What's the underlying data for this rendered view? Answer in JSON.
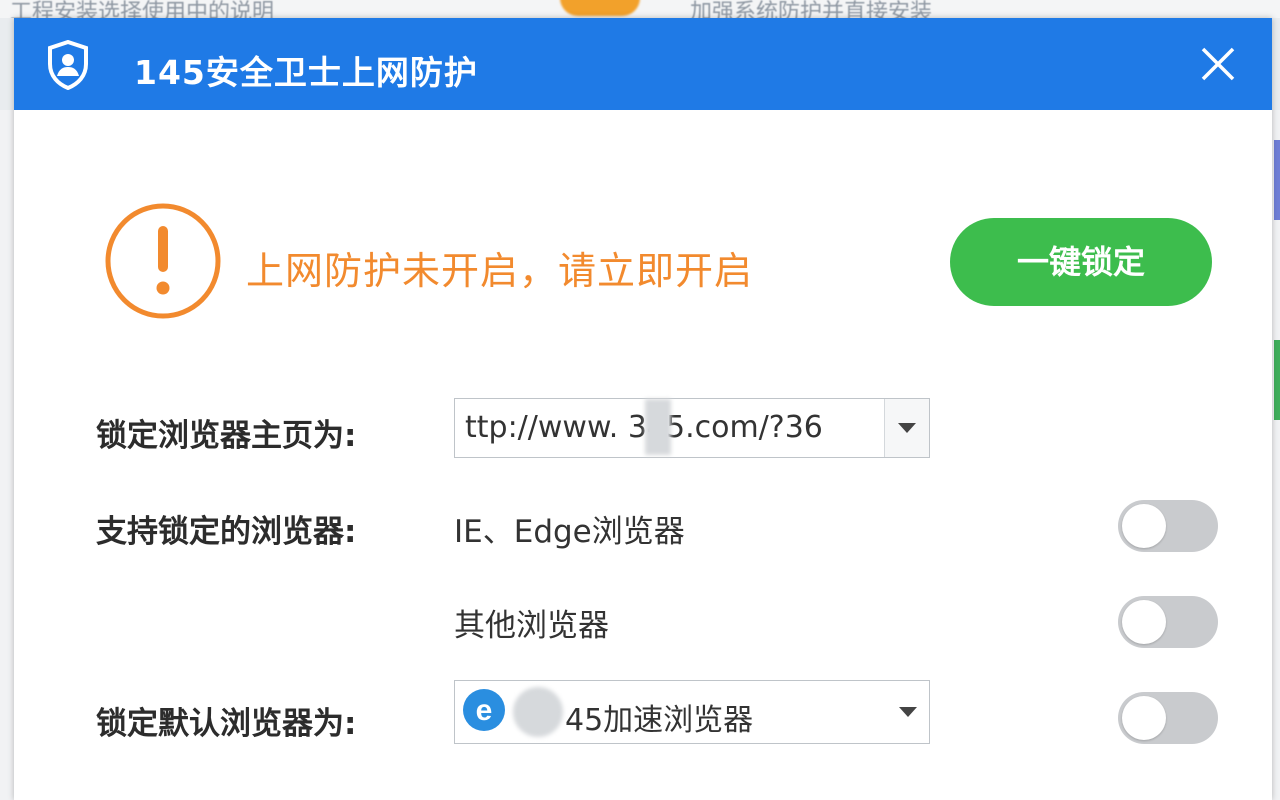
{
  "background": {
    "top_text_left": "工程安装选择使用中的说明",
    "top_text_right": "加强系统防护并直接安装"
  },
  "dialog": {
    "title": "145安全卫士上网防护",
    "icons": {
      "logo": "shield-user-icon",
      "close": "close-icon"
    }
  },
  "status": {
    "message": "上网防护未开启，请立即开启",
    "icon": "warning-circle-icon",
    "lock_button": "一键锁定"
  },
  "form": {
    "homepage_label": "锁定浏览器主页为:",
    "homepage_value": "ttp://www.  345.com/?36",
    "supported_label": "支持锁定的浏览器:",
    "browsers": [
      {
        "name": "IE、Edge浏览器",
        "enabled": false
      },
      {
        "name": "其他浏览器",
        "enabled": false
      }
    ],
    "default_label": "锁定默认浏览器为:",
    "default_value": "45加速浏览器",
    "default_enabled": false
  },
  "colors": {
    "titlebar": "#1f7ae6",
    "warning": "#f28a2e",
    "lock_button": "#3dbd4d",
    "toggle_off": "#c9cbce"
  }
}
